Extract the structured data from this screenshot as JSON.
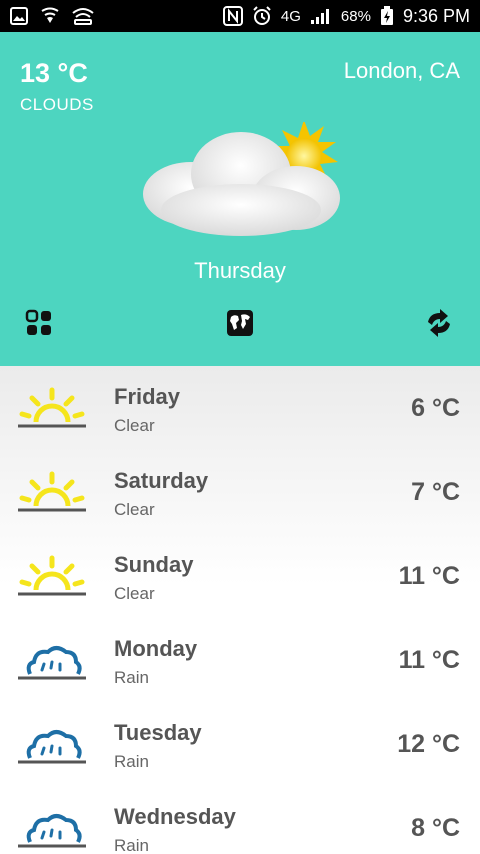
{
  "status_bar": {
    "battery": "68%",
    "network": "4G",
    "time": "9:36 PM"
  },
  "current": {
    "temperature": "13 °C",
    "condition": "CLOUDS",
    "location": "London, CA",
    "day": "Thursday",
    "icon": "cloud-sun-icon"
  },
  "toolbar": {
    "grid": "grid-icon",
    "map": "world-map-icon",
    "refresh": "refresh-icon"
  },
  "forecast": [
    {
      "day": "Friday",
      "condition": "Clear",
      "temp": "6 °C",
      "icon": "sunrise-icon"
    },
    {
      "day": "Saturday",
      "condition": "Clear",
      "temp": "7 °C",
      "icon": "sunrise-icon"
    },
    {
      "day": "Sunday",
      "condition": "Clear",
      "temp": "11 °C",
      "icon": "sunrise-icon"
    },
    {
      "day": "Monday",
      "condition": "Rain",
      "temp": "11 °C",
      "icon": "rain-cloud-icon"
    },
    {
      "day": "Tuesday",
      "condition": "Rain",
      "temp": "12 °C",
      "icon": "rain-cloud-icon"
    },
    {
      "day": "Wednesday",
      "condition": "Rain",
      "temp": "8 °C",
      "icon": "rain-cloud-icon"
    }
  ],
  "colors": {
    "header_bg": "#4dd5c0",
    "sun_yellow": "#f5e51c",
    "rain_blue": "#1e6fa6",
    "horizon_gray": "#555555"
  }
}
